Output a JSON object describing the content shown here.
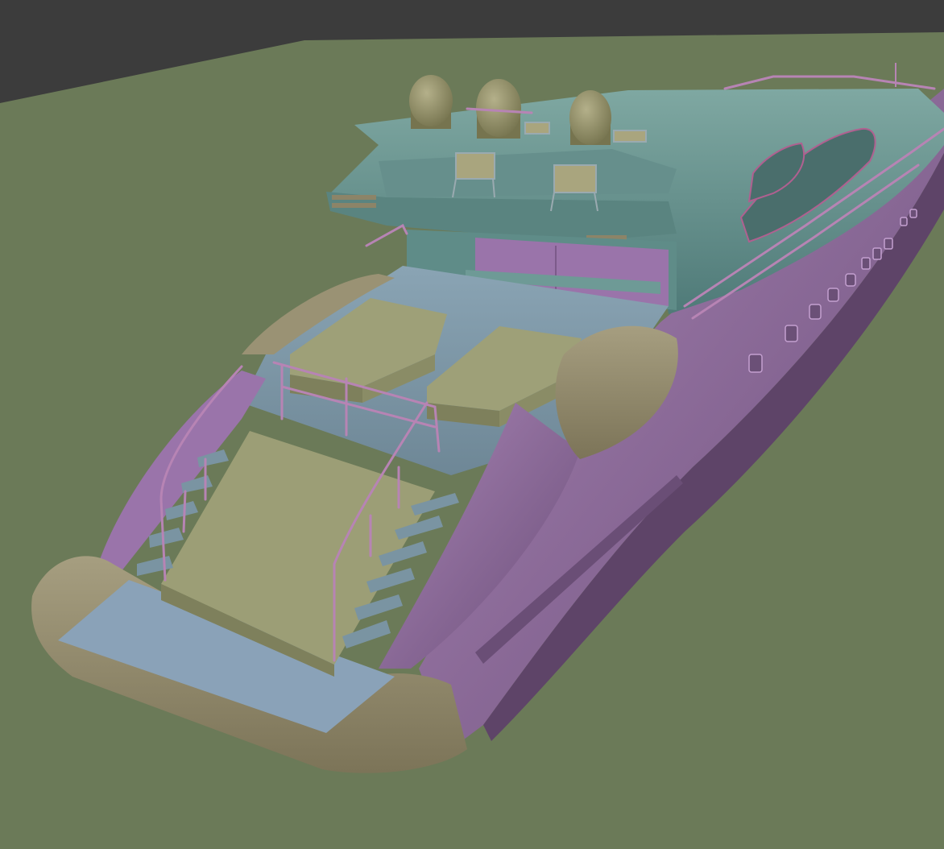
{
  "scene": {
    "kind": "3d-viewport-render",
    "subject": "motor-yacht-model",
    "colors": {
      "background": "#3c3c3c",
      "ground": "#6b7a58",
      "hull": "#8e6a9c",
      "hull_light": "#a884b4",
      "hull_dark": "#6c4f7a",
      "fender": "#8c8468",
      "fender_light": "#a69e80",
      "superstructure": "#5f8c88",
      "superstructure_light": "#78a6a0",
      "deck": "#6e8796",
      "deck_light": "#8aa4b4",
      "cushion": "#9ea078",
      "railing": "#b784b4",
      "dome": "#8e8c68"
    }
  }
}
